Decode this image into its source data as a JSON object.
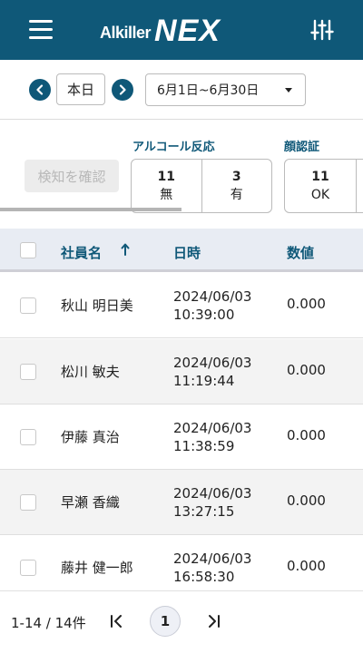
{
  "header": {
    "logo_small": "Alkiller",
    "logo_big": "NEX",
    "menu_icon": "hamburger-menu-icon",
    "filter_icon": "sliders-icon",
    "brand_color": "#0f5878"
  },
  "datebar": {
    "prev_icon": "chevron-left-icon",
    "today_label": "本日",
    "next_icon": "chevron-right-icon",
    "range_label": "6月1日~6月30日"
  },
  "summary": {
    "detect_button_label": "検知を確認",
    "alcohol": {
      "label": "アルコール反応",
      "none_count": "11",
      "none_label": "無",
      "yes_count": "3",
      "yes_label": "有"
    },
    "face": {
      "label": "顔認証",
      "ok_count": "11",
      "ok_label": "OK"
    }
  },
  "table": {
    "columns": {
      "name": "社員名",
      "datetime": "日時",
      "value": "数値"
    },
    "sort_icon": "arrow-up-icon",
    "rows": [
      {
        "name": "秋山 明日美",
        "date": "2024/06/03",
        "time": "10:39:00",
        "value": "0.000"
      },
      {
        "name": "松川 敏夫",
        "date": "2024/06/03",
        "time": "11:19:44",
        "value": "0.000"
      },
      {
        "name": "伊藤 真治",
        "date": "2024/06/03",
        "time": "11:38:59",
        "value": "0.000"
      },
      {
        "name": "早瀬 香織",
        "date": "2024/06/03",
        "time": "13:27:15",
        "value": "0.000"
      },
      {
        "name": "藤井 健一郎",
        "date": "2024/06/03",
        "time": "16:58:30",
        "value": "0.000"
      }
    ]
  },
  "pager": {
    "count_label": "1-14 / 14件",
    "current_page": "1",
    "first_icon": "first-page-icon",
    "last_icon": "last-page-icon"
  }
}
